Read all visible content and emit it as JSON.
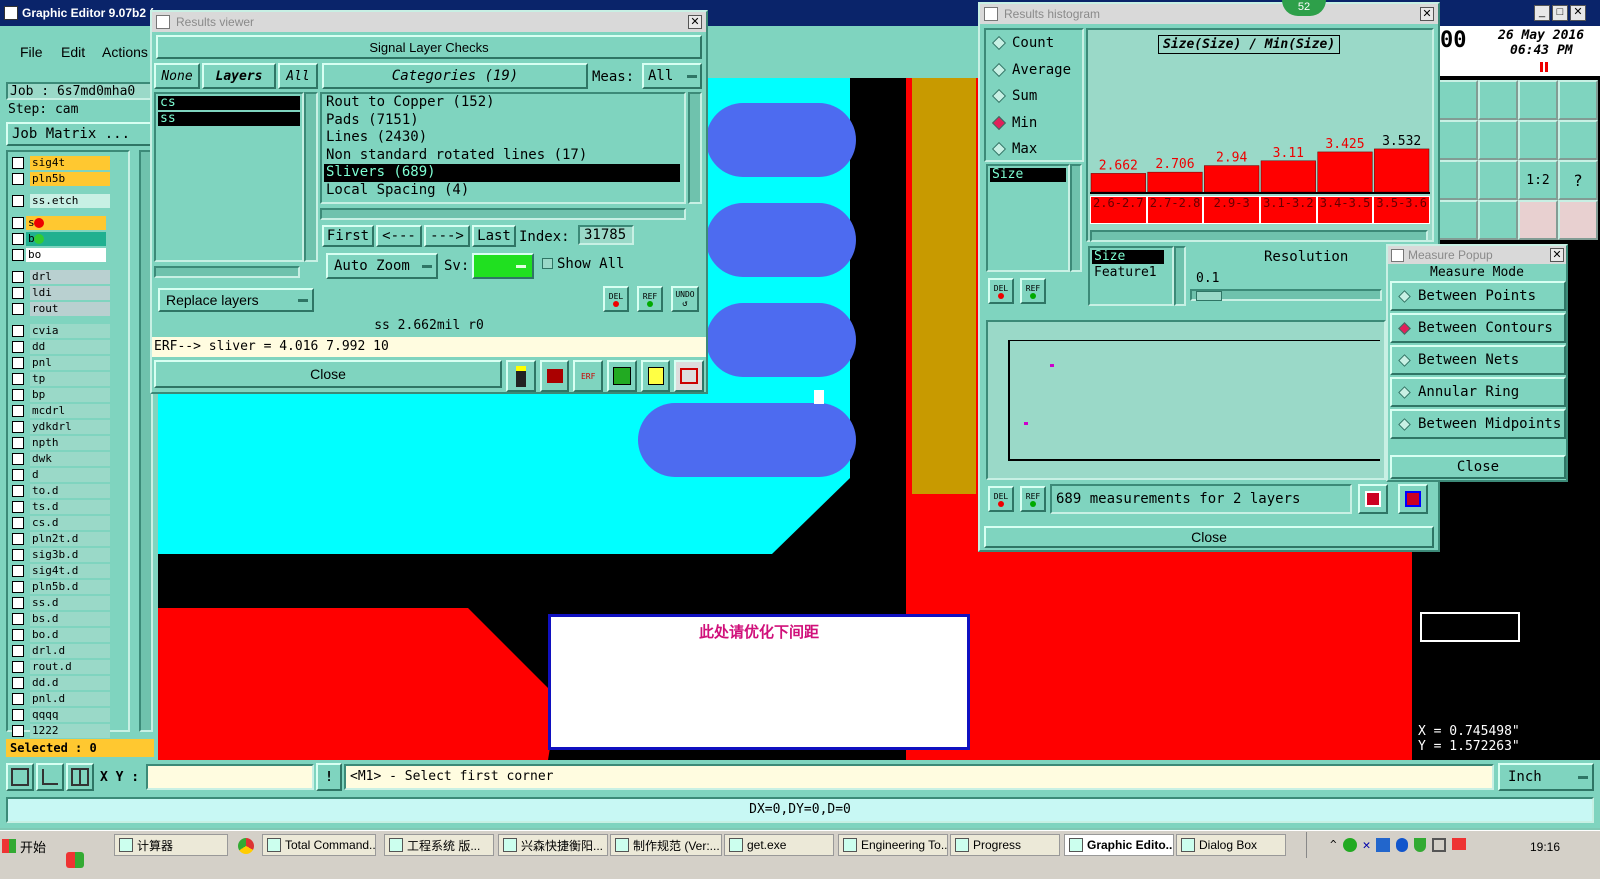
{
  "main_window": {
    "title": "Graphic Editor 9.07b2 (",
    "menu": [
      "File",
      "Edit",
      "Actions"
    ]
  },
  "job": {
    "job_line": "Job : 6s7md0mha0",
    "step_line": "Step: cam",
    "matrix_button": "Job Matrix ..."
  },
  "layers": {
    "top": [
      "sig4t",
      "pln5b"
    ],
    "etch": [
      "ss.etch"
    ],
    "work": [
      "ss",
      "bs",
      "bo"
    ],
    "drill": [
      "drl",
      "ldi",
      "rout"
    ],
    "list": [
      "cvia",
      "dd",
      "pnl",
      "tp",
      "bp",
      "mcdrl",
      "ydkdrl",
      "npth",
      "dwk",
      "d",
      "to.d",
      "ts.d",
      "cs.d",
      "pln2t.d",
      "sig3b.d",
      "sig4t.d",
      "pln5b.d",
      "ss.d",
      "bs.d",
      "bo.d",
      "drl.d",
      "rout.d",
      "dd.d",
      "pnl.d",
      "qqqq",
      "1222"
    ],
    "selected": "Selected : 0"
  },
  "colors": {
    "cyan": "#00ffff",
    "red": "#ff0000",
    "blue_pad": "#4d6bf0",
    "gold": "#c89a00",
    "panel": "#7fd4bf",
    "highlight_yellow": "#ffc830"
  },
  "results_viewer": {
    "title": "Results viewer",
    "header": "Signal Layer Checks",
    "none_btn": "None",
    "layers_btn": "Layers",
    "all_btn": "All",
    "layers": [
      "cs",
      "ss"
    ],
    "categories_label": "Categories (19)",
    "meas_label": "Meas:",
    "meas_value": "All",
    "categories": [
      "Rout to Copper (152)",
      "Pads (7151)",
      "Lines (2430)",
      "Non standard rotated lines (17)",
      "Slivers (689)",
      "Local Spacing (4)"
    ],
    "first": "First",
    "prev": "<---",
    "next": "--->",
    "last": "Last",
    "index_label": "Index:",
    "index_value": "31785",
    "auto_zoom": "Auto Zoom",
    "sv": "Sv:",
    "show_all": "Show All",
    "replace_layers": "Replace layers",
    "del": "DEL",
    "ref": "REF",
    "undo": "UNDO",
    "status": "ss 2.662mil  r0",
    "erf": "ERF--> sliver = 4.016 7.992 10",
    "close": "Close"
  },
  "histogram": {
    "title": "Results histogram",
    "options": [
      "Count",
      "Average",
      "Sum",
      "Min",
      "Max"
    ],
    "selected_option": "Min",
    "chart_title": "Size(Size) / Min(Size)",
    "bar_values": [
      "2.662",
      "2.706",
      "2.94",
      "3.11",
      "3.425",
      "3.532"
    ],
    "bins": [
      "2.6-2.7",
      "2.7-2.8",
      "2.9-3",
      "3.1-3.2",
      "3.4-3.5",
      "3.5-3.6"
    ],
    "list_item": "Size",
    "attr_items": [
      "Size",
      "Feature1"
    ],
    "resolution_label": "Resolution",
    "resolution_value": "0.1",
    "summary": "689 measurements for 2 layers",
    "close": "Close",
    "badge": "52"
  },
  "chart_data": {
    "type": "bar",
    "title": "Size(Size) / Min(Size)",
    "categories": [
      "2.6-2.7",
      "2.7-2.8",
      "2.9-3",
      "3.1-3.2",
      "3.4-3.5",
      "3.5-3.6"
    ],
    "values": [
      2.662,
      2.706,
      2.94,
      3.11,
      3.425,
      3.532
    ]
  },
  "measure_popup": {
    "title": "Measure Popup",
    "mode_label": "Measure Mode",
    "modes": [
      "Between Points",
      "Between Contours",
      "Between Nets",
      "Annular Ring",
      "Between Midpoints"
    ],
    "selected_mode": "Between Contours",
    "close": "Close"
  },
  "clock": {
    "date": "26 May 2016",
    "time": "06:43 PM",
    "left": "00"
  },
  "coords": {
    "x": "X = 0.745498\"",
    "y": "Y = 1.572263\""
  },
  "canvas": {
    "annotation": "此处请优化下间距"
  },
  "status_bar": {
    "xy_label": "X Y :",
    "prompt": "<M1> - Select first corner",
    "units": "Inch",
    "dx": "DX=0,DY=0,D=0"
  },
  "taskbar": {
    "start": "开始",
    "items": [
      "计算器",
      "Total Command...",
      "工程系统  版...",
      "兴森快捷衡阳...",
      "制作规范 (Ver:...",
      "get.exe",
      "Engineering To...",
      "Progress",
      "Graphic Edito...",
      "Dialog Box"
    ],
    "time": "19:16"
  }
}
